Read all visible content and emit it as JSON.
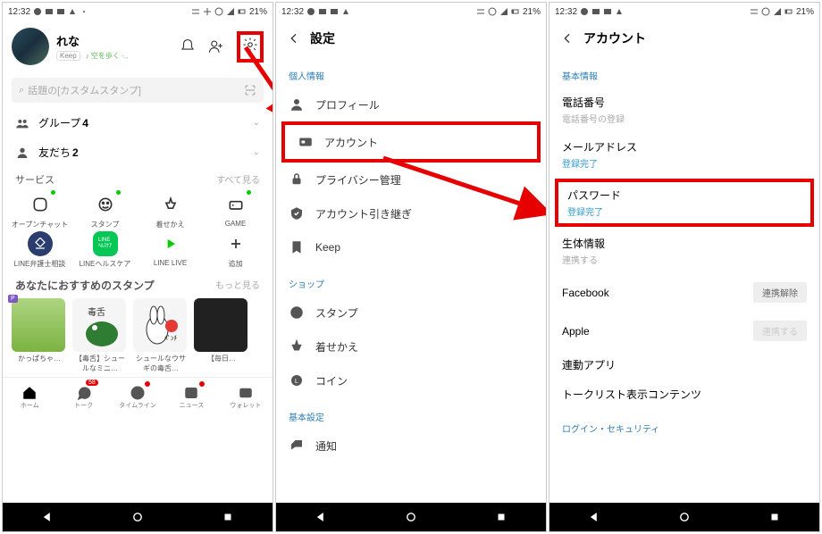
{
  "status": {
    "time": "12:32",
    "battery": "21%"
  },
  "s1": {
    "name": "れな",
    "keep": "Keep",
    "music": "♪ 空を歩く -..",
    "search_placeholder": "話題の[カスタムスタンプ]",
    "group_label": "グループ",
    "group_count": "4",
    "friend_label": "友だち",
    "friend_count": "2",
    "service_hdr": "サービス",
    "see_all": "すべて見る",
    "services": [
      {
        "label": "オープンチャット"
      },
      {
        "label": "スタンプ"
      },
      {
        "label": "着せかえ"
      },
      {
        "label": "GAME"
      },
      {
        "label": "LINE弁護士相談"
      },
      {
        "label": "LINEヘルスケア"
      },
      {
        "label": "LINE LIVE"
      },
      {
        "label": "追加"
      }
    ],
    "sticker_hdr": "あなたにおすすめのスタンプ",
    "more": "もっと見る",
    "stickers": [
      {
        "label": "かっぱちゃ…"
      },
      {
        "label": "【毒舌】シュールなミニ…"
      },
      {
        "label": "シュールなウサギの毒舌…"
      },
      {
        "label": "【毎日…"
      }
    ],
    "tabs": [
      {
        "label": "ホーム"
      },
      {
        "label": "トーク",
        "badge": "58"
      },
      {
        "label": "タイムライン"
      },
      {
        "label": "ニュース"
      },
      {
        "label": "ウォレット"
      }
    ]
  },
  "s2": {
    "title": "設定",
    "sec1": "個人情報",
    "items1": [
      "プロフィール",
      "アカウント",
      "プライバシー管理",
      "アカウント引き継ぎ",
      "Keep"
    ],
    "sec2": "ショップ",
    "items2": [
      "スタンプ",
      "着せかえ",
      "コイン"
    ],
    "sec3": "基本設定",
    "items3": [
      "通知"
    ]
  },
  "s3": {
    "title": "アカウント",
    "sec1": "基本情報",
    "rows": [
      {
        "t": "電話番号",
        "s": "電話番号の登録",
        "link": false
      },
      {
        "t": "メールアドレス",
        "s": "登録完了",
        "link": true
      },
      {
        "t": "パスワード",
        "s": "登録完了",
        "link": true,
        "boxed": true
      },
      {
        "t": "生体情報",
        "s": "連携する",
        "link": false
      }
    ],
    "fb": {
      "t": "Facebook",
      "b": "連携解除"
    },
    "apple": {
      "t": "Apple",
      "b": "連携する"
    },
    "linked": "連動アプリ",
    "talk": "トークリスト表示コンテンツ",
    "sec2": "ログイン・セキュリティ"
  }
}
